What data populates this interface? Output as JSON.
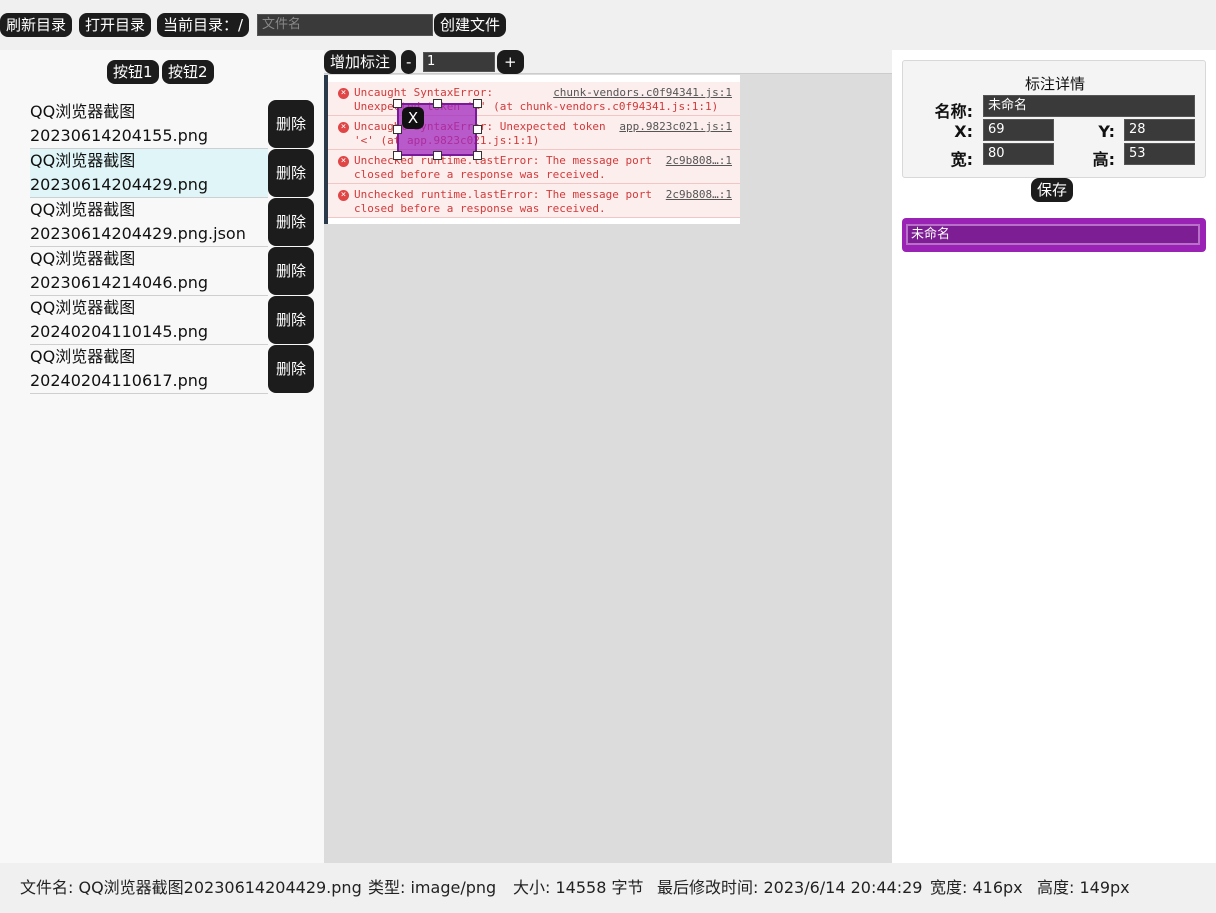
{
  "toolbar": {
    "refresh_label": "刷新目录",
    "open_label": "打开目录",
    "current_dir_label": "当前目录：/",
    "filename_placeholder": "文件名",
    "create_label": "创建文件"
  },
  "sidebar": {
    "button1": "按钮1",
    "button2": "按钮2",
    "delete_label": "删除",
    "files": [
      {
        "line1": "QQ浏览器截图",
        "line2": "20230614204155.png"
      },
      {
        "line1": "QQ浏览器截图",
        "line2": "20230614204429.png"
      },
      {
        "line1": "QQ浏览器截图",
        "line2": "20230614204429.png.json"
      },
      {
        "line1": "QQ浏览器截图",
        "line2": "20230614214046.png"
      },
      {
        "line1": "QQ浏览器截图",
        "line2": "20240204110145.png"
      },
      {
        "line1": "QQ浏览器截图",
        "line2": "20240204110617.png"
      }
    ]
  },
  "canvas": {
    "add_label": "增加标注",
    "minus_label": "-",
    "plus_label": "+",
    "zoom_value": "1",
    "annotation_close": "X",
    "errors": [
      {
        "l1": "Uncaught SyntaxError:",
        "l2": "Unexpected token '<' (at chunk-vendors.c0f94341.js:1:1)",
        "src": "chunk-vendors.c0f94341.js:1"
      },
      {
        "l1": "Uncaught SyntaxError: Unexpected token",
        "l2": "'<' (at app.9823c021.js:1:1)",
        "src": "app.9823c021.js:1"
      },
      {
        "l1": "Unchecked runtime.lastError: The message port",
        "l2": "closed before a response was received.",
        "src": "2c9b808…:1"
      },
      {
        "l1": "Unchecked runtime.lastError: The message port",
        "l2": "closed before a response was received.",
        "src": "2c9b808…:1"
      }
    ]
  },
  "details": {
    "title": "标注详情",
    "name_label": "名称:",
    "name_value": "未命名",
    "x_label": "X:",
    "x_value": "69",
    "y_label": "Y:",
    "y_value": "28",
    "w_label": "宽:",
    "w_value": "80",
    "h_label": "高:",
    "h_value": "53",
    "save_label": "保存",
    "list": [
      {
        "name": "未命名",
        "color": "#9a22b4"
      }
    ]
  },
  "status": {
    "filename": "文件名: QQ浏览器截图20230614204429.png",
    "type": "类型: image/png",
    "size": "大小: 14558 字节",
    "modified": "最后修改时间: 2023/6/14 20:44:29",
    "width": "宽度: 416px",
    "height": "高度: 149px"
  }
}
